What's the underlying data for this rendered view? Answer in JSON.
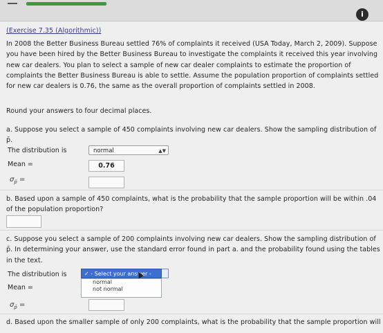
{
  "progress_percent": 100,
  "title": "(Exercise 7.35 (Algorithmic))",
  "intro_lines": [
    "In 2008 the Better Business Bureau settled 76% of complaints it received (USA Today, March 2, 2009). Suppose",
    "you have been hired by the Better Business Bureau to investigate the complaints it received this year involving",
    "new car dealers. You plan to select a sample of new car dealer complaints to estimate the proportion of",
    "complaints the Better Business Bureau is able to settle. Assume the population proportion of complaints settled",
    "for new car dealers is 0.76, the same as the overall proportion of complaints settled in 2008."
  ],
  "round_text": "Round your answers to four decimal places.",
  "part_a": {
    "lines": [
      "a. Suppose you select a sample of 450 complaints involving new car dealers. Show the sampling distribution of",
      "p̄."
    ],
    "dist_label": "The distribution is",
    "dist_value": "normal",
    "mean_label": "Mean =",
    "mean_value": "0.76",
    "sigma_label": "σ",
    "sigma_sub": "p̄",
    "sigma_eq": "=",
    "sigma_value": ""
  },
  "part_b": {
    "lines": [
      "b. Based upon a sample of 450 complaints, what is the probability that the sample proportion will be within .04",
      "of the population proportion?"
    ],
    "answer_value": ""
  },
  "part_c": {
    "lines": [
      "c. Suppose you select a sample of 200 complaints involving new car dealers. Show the sampling distribution of",
      "p̄. In determining your answer, use the standard error found in part a. and the probability found using the tables",
      "in the text."
    ],
    "dist_label": "The distribution is",
    "dropdown_selected": "✓ - Select your answer -",
    "dropdown_options": [
      "normal",
      "not normal"
    ],
    "mean_label": "Mean =",
    "mean_value": "",
    "sigma_label": "σ",
    "sigma_sub": "p̄",
    "sigma_eq": "=",
    "sigma_value": ""
  },
  "part_d": {
    "lines": [
      "d. Based upon the smaller sample of only 200 complaints, what is the probability that the sample proportion will"
    ]
  },
  "icons": {
    "info": "i"
  }
}
